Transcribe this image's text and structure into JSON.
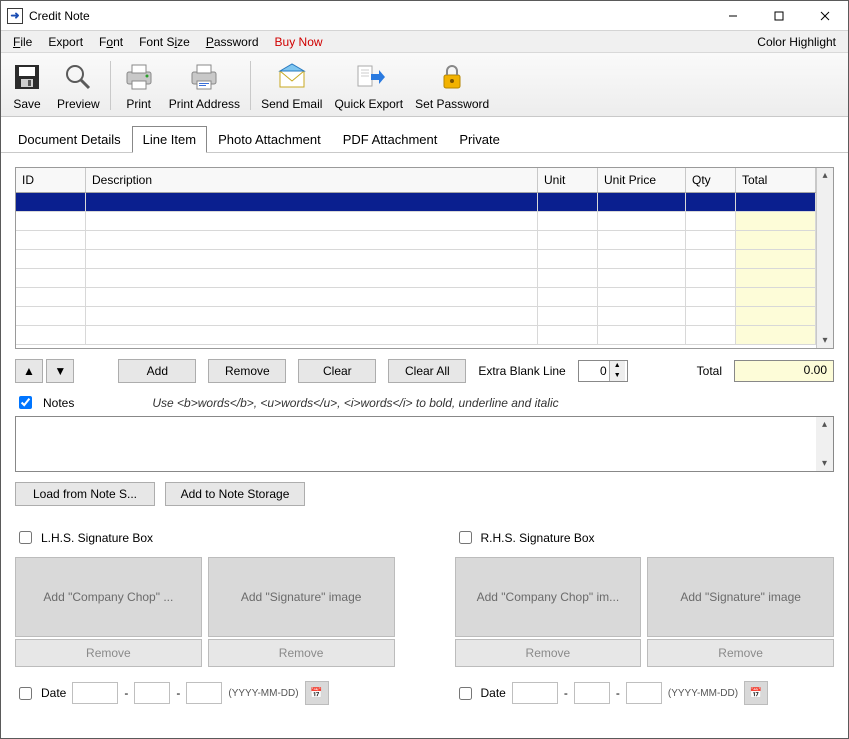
{
  "window": {
    "title": "Credit Note"
  },
  "menu": {
    "file": "File",
    "export": "Export",
    "font": "Font",
    "fontsize": "Font Size",
    "password": "Password",
    "buynow": "Buy Now",
    "color_highlight": "Color Highlight"
  },
  "toolbar": {
    "save": "Save",
    "preview": "Preview",
    "print": "Print",
    "print_address": "Print Address",
    "send_email": "Send Email",
    "quick_export": "Quick Export",
    "set_password": "Set Password"
  },
  "tabs": {
    "doc_details": "Document Details",
    "line_item": "Line Item",
    "photo": "Photo Attachment",
    "pdf": "PDF Attachment",
    "private": "Private"
  },
  "grid": {
    "headers": {
      "id": "ID",
      "description": "Description",
      "unit": "Unit",
      "unit_price": "Unit Price",
      "qty": "Qty",
      "total": "Total"
    }
  },
  "actions": {
    "add": "Add",
    "remove": "Remove",
    "clear": "Clear",
    "clear_all": "Clear All",
    "extra_blank_line": "Extra Blank Line",
    "extra_blank_value": "0",
    "total_label": "Total",
    "total_value": "0.00"
  },
  "notes": {
    "label": "Notes",
    "hint": "Use <b>words</b>, <u>words</u>, <i>words</i> to bold, underline and italic",
    "load": "Load from Note S...",
    "add_storage": "Add to Note Storage"
  },
  "sig": {
    "lhs_label": "L.H.S. Signature Box",
    "rhs_label": "R.H.S. Signature Box",
    "add_chop_l": "Add \"Company Chop\" ...",
    "add_chop_r": "Add \"Company Chop\" im...",
    "add_sig": "Add \"Signature\" image",
    "remove": "Remove",
    "date_label": "Date",
    "date_hint": "(YYYY-MM-DD)"
  }
}
